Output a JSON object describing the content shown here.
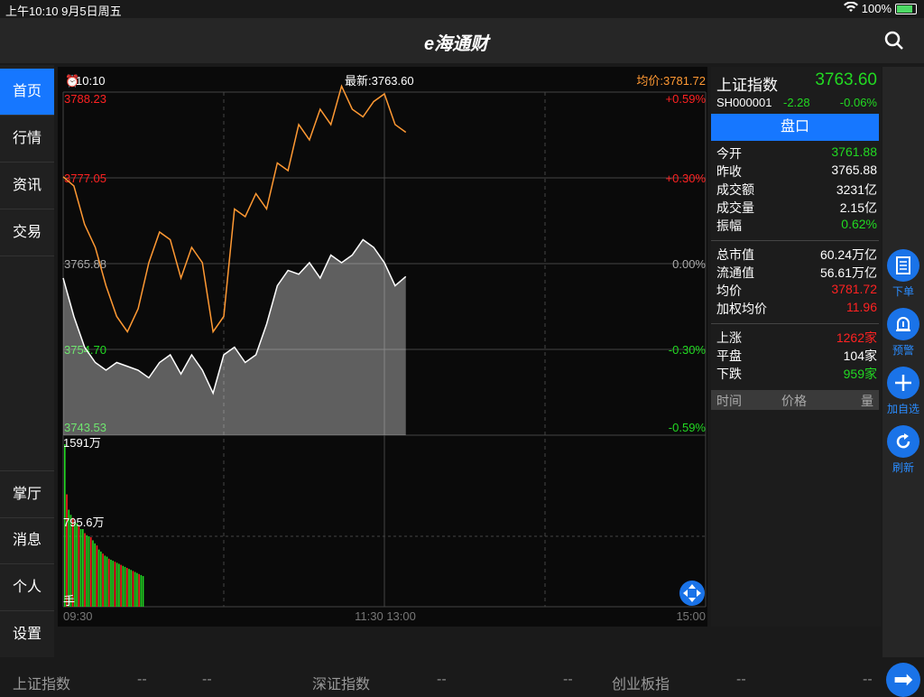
{
  "status": {
    "time_date": "上午10:10  9月5日周五",
    "battery": "100%"
  },
  "app": {
    "logo": "e海通财"
  },
  "sidebar": {
    "top_items": [
      {
        "label": "首页",
        "active": true
      },
      {
        "label": "行情"
      },
      {
        "label": "资讯"
      },
      {
        "label": "交易"
      }
    ],
    "bottom_items": [
      {
        "label": "掌厅"
      },
      {
        "label": "消息"
      },
      {
        "label": "个人"
      },
      {
        "label": "设置"
      }
    ]
  },
  "chart_header": {
    "time": "10:10",
    "latest": "最新:3763.60",
    "avg": "均价:3781.72"
  },
  "chart_data": {
    "type": "line",
    "y_left_labels": [
      "3788.23",
      "3777.05",
      "3765.88",
      "3754.70",
      "3743.53"
    ],
    "y_right_labels": [
      "+0.59%",
      "+0.30%",
      "0.00%",
      "-0.30%",
      "-0.59%"
    ],
    "x_labels": [
      "09:30",
      "11:30 13:00",
      "15:00"
    ],
    "volume_labels": [
      "1591万",
      "795.6万",
      "手"
    ],
    "ylim": [
      3743.53,
      3788.23
    ],
    "series": [
      {
        "values": [
          3777.2,
          3776.0,
          3771.0,
          3768.0,
          3763.0,
          3759.0,
          3757.0,
          3760.0,
          3766.0,
          3770.0,
          3769.0,
          3764.0,
          3768.0,
          3766.0,
          3757.0,
          3759.0,
          3773.0,
          3772.0,
          3775.0,
          3773.0,
          3779.0,
          3778.0,
          3784.0,
          3782.0,
          3786.0,
          3784.0,
          3789.0,
          3786.0,
          3785.0,
          3787.0,
          3788.0,
          3784.0,
          3783.0
        ]
      },
      {
        "values": [
          3764.0,
          3759.0,
          3755.0,
          3753.0,
          3752.0,
          3753.0,
          3752.5,
          3752.0,
          3751.0,
          3753.0,
          3754.0,
          3751.5,
          3754.0,
          3752.0,
          3749.0,
          3754.0,
          3755.0,
          3753.0,
          3754.0,
          3758.0,
          3763.0,
          3765.0,
          3764.5,
          3766.0,
          3764.0,
          3767.0,
          3766.0,
          3767.0,
          3769.0,
          3768.0,
          3766.0,
          3763.0,
          3764.2
        ]
      }
    ],
    "volumes": [
      1591,
      1100,
      950,
      900,
      870,
      830,
      820,
      800,
      760,
      760,
      720,
      700,
      690,
      680,
      650,
      620,
      600,
      560,
      540,
      520,
      500,
      490,
      470,
      460,
      450,
      440,
      430,
      420,
      410,
      400,
      390,
      380,
      370,
      360,
      350,
      340,
      330,
      320,
      310,
      300,
      300,
      290,
      280,
      270,
      260,
      250,
      240,
      240,
      230,
      220,
      220,
      210,
      200,
      200,
      190,
      185,
      180,
      175,
      170,
      165,
      160,
      155,
      150,
      145,
      140,
      135,
      130,
      125,
      120,
      115,
      110,
      105,
      100,
      100,
      95,
      90,
      85,
      80,
      75,
      70,
      68,
      66,
      64,
      62,
      60,
      58,
      56,
      54,
      52,
      50,
      48,
      46,
      44,
      42,
      40,
      38,
      36,
      34,
      32,
      30,
      28,
      26,
      24,
      22,
      20,
      18,
      16,
      14,
      12,
      10,
      8,
      6,
      4,
      2,
      1,
      1,
      1,
      1,
      1,
      1
    ]
  },
  "quote": {
    "name": "上证指数",
    "price": "3763.60",
    "code": "SH000001",
    "change": "-2.28",
    "pct": "-0.06%",
    "pankou": "盘口",
    "rows1": [
      [
        "今开",
        "3761.88"
      ],
      [
        "昨收",
        "3765.88"
      ],
      [
        "成交额",
        "3231亿"
      ],
      [
        "成交量",
        "2.15亿"
      ],
      [
        "振幅",
        "0.62%"
      ]
    ],
    "rows2": [
      [
        "总市值",
        "60.24万亿"
      ],
      [
        "流通值",
        "56.61万亿"
      ],
      [
        "均价",
        "3781.72"
      ],
      [
        "加权均价",
        "11.96"
      ]
    ],
    "rows3": [
      [
        "上涨",
        "1262家"
      ],
      [
        "平盘",
        "104家"
      ],
      [
        "下跌",
        "959家"
      ]
    ],
    "table_head": [
      "时间",
      "价格",
      "量"
    ]
  },
  "actions": [
    {
      "label": "下单",
      "icon": "order-icon"
    },
    {
      "label": "预警",
      "icon": "alarm-icon"
    },
    {
      "label": "加自选",
      "icon": "plus-icon"
    },
    {
      "label": "刷新",
      "icon": "refresh-icon"
    }
  ],
  "bottom": {
    "items": [
      "上证指数",
      "--",
      "--",
      "深证指数",
      "--",
      "--",
      "创业板指",
      "--",
      "--"
    ]
  }
}
